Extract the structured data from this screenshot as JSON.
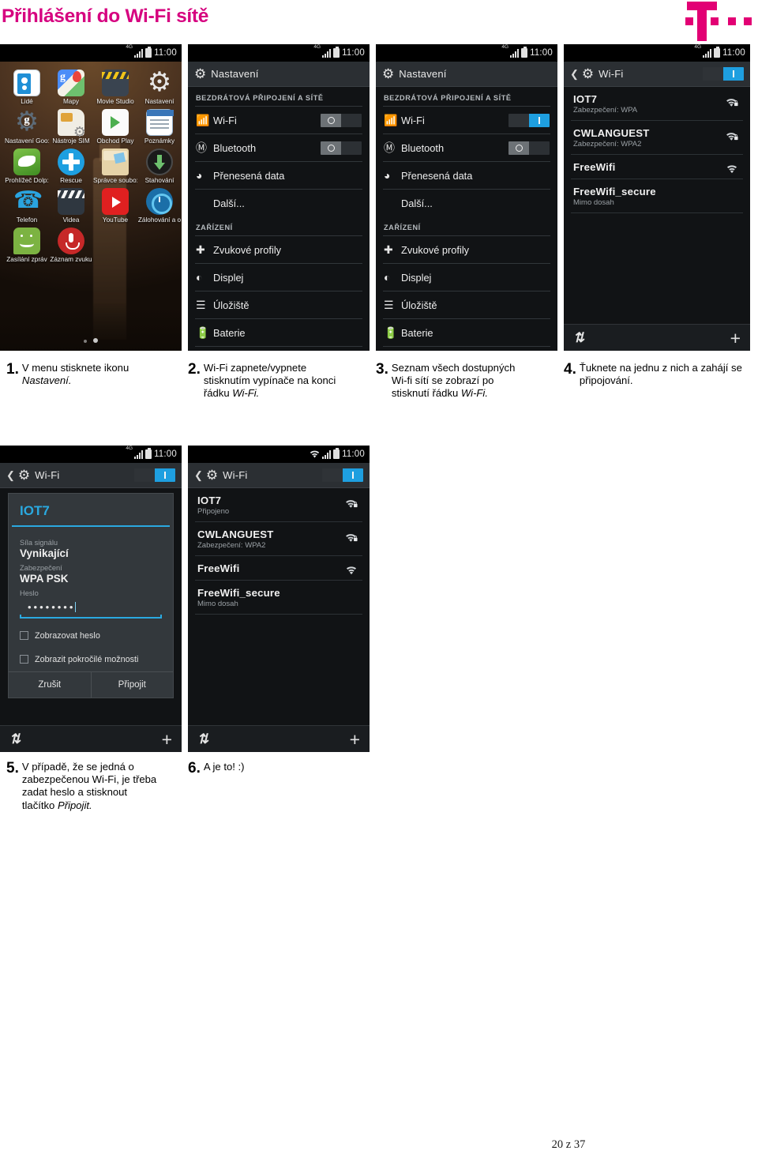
{
  "header": {
    "title": "Přihlášení do Wi-Fi sítě",
    "logo_name": "t-mobile-logo",
    "brand_color": "#d6007f"
  },
  "footer": {
    "page_label": "20 z 37"
  },
  "common": {
    "status_time": "11:00",
    "accent_blue": "#1e9fe0"
  },
  "screens": [
    {
      "id": "home",
      "type": "android-home",
      "status_time": "11:00",
      "apps": [
        {
          "label": "Lidé",
          "icon": "people-icon"
        },
        {
          "label": "Mapy",
          "icon": "maps-icon"
        },
        {
          "label": "Movie Studio",
          "icon": "movie-studio-icon"
        },
        {
          "label": "Nastavení",
          "icon": "settings-gear-icon"
        },
        {
          "label": "Nastavení Goo:",
          "icon": "google-settings-icon"
        },
        {
          "label": "Nástroje SIM",
          "icon": "sim-tools-icon"
        },
        {
          "label": "Obchod Play",
          "icon": "play-store-icon"
        },
        {
          "label": "Poznámky",
          "icon": "notes-icon"
        },
        {
          "label": "Prohlížeč Dolp:",
          "icon": "dolphin-browser-icon"
        },
        {
          "label": "Rescue",
          "icon": "rescue-icon"
        },
        {
          "label": "Správce soubo:",
          "icon": "file-manager-icon"
        },
        {
          "label": "Stahování",
          "icon": "downloads-icon"
        },
        {
          "label": "Telefon",
          "icon": "phone-icon"
        },
        {
          "label": "Videa",
          "icon": "videos-icon"
        },
        {
          "label": "YouTube",
          "icon": "youtube-icon"
        },
        {
          "label": "Zálohování a o",
          "icon": "backup-icon"
        },
        {
          "label": "Zasílání zpráv",
          "icon": "messaging-icon"
        },
        {
          "label": "Záznam zvuku",
          "icon": "sound-recorder-icon"
        }
      ]
    },
    {
      "id": "settings-wifi-off",
      "type": "android-settings",
      "status_time": "11:00",
      "title": "Nastavení",
      "sections": [
        {
          "header": "BEZDRÁTOVÁ PŘIPOJENÍ A SÍTĚ",
          "rows": [
            {
              "label": "Wi-Fi",
              "icon": "wifi-icon",
              "toggle": "off"
            },
            {
              "label": "Bluetooth",
              "icon": "bluetooth-icon",
              "toggle": "off"
            },
            {
              "label": "Přenesená data",
              "icon": "data-usage-icon"
            },
            {
              "label": "Další...",
              "icon": ""
            }
          ]
        },
        {
          "header": "ZAŘÍZENÍ",
          "rows": [
            {
              "label": "Zvukové profily",
              "icon": "sound-icon"
            },
            {
              "label": "Displej",
              "icon": "display-icon"
            },
            {
              "label": "Úložiště",
              "icon": "storage-icon"
            },
            {
              "label": "Baterie",
              "icon": "battery-icon"
            }
          ]
        }
      ]
    },
    {
      "id": "settings-wifi-on",
      "type": "android-settings",
      "status_time": "11:00",
      "title": "Nastavení",
      "sections": [
        {
          "header": "BEZDRÁTOVÁ PŘIPOJENÍ A SÍTĚ",
          "rows": [
            {
              "label": "Wi-Fi",
              "icon": "wifi-icon",
              "toggle": "on"
            },
            {
              "label": "Bluetooth",
              "icon": "bluetooth-icon",
              "toggle": "off"
            },
            {
              "label": "Přenesená data",
              "icon": "data-usage-icon"
            },
            {
              "label": "Další...",
              "icon": ""
            }
          ]
        },
        {
          "header": "ZAŘÍZENÍ",
          "rows": [
            {
              "label": "Zvukové profily",
              "icon": "sound-icon"
            },
            {
              "label": "Displej",
              "icon": "display-icon"
            },
            {
              "label": "Úložiště",
              "icon": "storage-icon"
            },
            {
              "label": "Baterie",
              "icon": "battery-icon"
            }
          ]
        }
      ]
    },
    {
      "id": "wifi-list",
      "type": "android-wifi-list",
      "status_time": "11:00",
      "title": "Wi-Fi",
      "toggle": "on",
      "networks": [
        {
          "ssid": "IOT7",
          "subtitle": "Zabezpečení: WPA",
          "icon": "wifi-lock-icon"
        },
        {
          "ssid": "CWLANGUEST",
          "subtitle": "Zabezpečení: WPA2",
          "icon": "wifi-lock-icon"
        },
        {
          "ssid": "FreeWifi",
          "subtitle": "",
          "icon": "wifi-open-icon"
        },
        {
          "ssid": "FreeWifi_secure",
          "subtitle": "Mimo dosah",
          "icon": ""
        }
      ],
      "bottom": {
        "scan": "scan-icon",
        "add": "add-network-icon"
      }
    },
    {
      "id": "wifi-password-dialog",
      "type": "android-wifi-dialog",
      "status_time": "11:00",
      "title": "Wi-Fi",
      "toggle": "on",
      "dialog": {
        "ssid": "IOT7",
        "fields": [
          {
            "label": "Síla signálu",
            "value": "Vynikající"
          },
          {
            "label": "Zabezpečení",
            "value": "WPA PSK"
          }
        ],
        "password_label": "Heslo",
        "password_value": "••••••••",
        "checkboxes": [
          {
            "label": "Zobrazovat heslo",
            "checked": false
          },
          {
            "label": "Zobrazit pokročilé možnosti",
            "checked": false
          }
        ],
        "buttons": [
          {
            "label": "Zrušit"
          },
          {
            "label": "Připojit"
          }
        ]
      },
      "bottom": {
        "scan": "scan-icon",
        "add": "add-network-icon"
      }
    },
    {
      "id": "wifi-list-connected",
      "type": "android-wifi-list",
      "status_time": "11:00",
      "title": "Wi-Fi",
      "toggle": "on",
      "networks": [
        {
          "ssid": "IOT7",
          "subtitle": "Připojeno",
          "icon": "wifi-lock-icon"
        },
        {
          "ssid": "CWLANGUEST",
          "subtitle": "Zabezpečení: WPA2",
          "icon": "wifi-lock-icon"
        },
        {
          "ssid": "FreeWifi",
          "subtitle": "",
          "icon": "wifi-open-icon"
        },
        {
          "ssid": "FreeWifi_secure",
          "subtitle": "Mimo dosah",
          "icon": ""
        }
      ],
      "bottom": {
        "scan": "scan-icon",
        "add": "add-network-icon"
      }
    }
  ],
  "steps": [
    {
      "num": "1.",
      "parts": [
        {
          "t": "V menu stisknete ikonu ",
          "i": false
        },
        {
          "t": "Nastavení.",
          "i": true
        }
      ]
    },
    {
      "num": "2.",
      "parts": [
        {
          "t": "Wi-Fi zapnete/vypnete stisknutím vypínače na konci řádku ",
          "i": false
        },
        {
          "t": "Wi-Fi.",
          "i": true
        }
      ]
    },
    {
      "num": "3.",
      "parts": [
        {
          "t": "Seznam všech dostupných Wi-fi sítí se zobrazí po stisknutí řádku ",
          "i": false
        },
        {
          "t": "Wi-Fi.",
          "i": true
        }
      ]
    },
    {
      "num": "4.",
      "parts": [
        {
          "t": "Ťuknete na jednu z nich a zahájí se připojování.",
          "i": false
        }
      ]
    },
    {
      "num": "5.",
      "parts": [
        {
          "t": "V případě, že se jedná o zabezpečenou Wi-Fi, je třeba zadat heslo a stisknout tlačítko ",
          "i": false
        },
        {
          "t": "Připojit.",
          "i": true
        }
      ]
    },
    {
      "num": "6.",
      "parts": [
        {
          "t": "A je to! :)",
          "i": false
        }
      ]
    }
  ]
}
